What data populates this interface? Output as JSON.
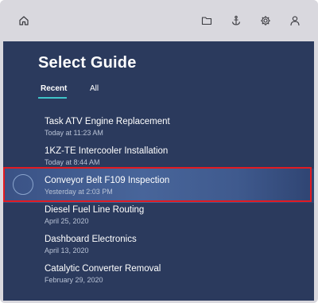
{
  "toolbar": {
    "home_icon": "home-icon",
    "folder_icon": "folder-icon",
    "anchor_icon": "anchor-icon",
    "settings_icon": "gear-icon",
    "user_icon": "user-icon"
  },
  "page": {
    "title": "Select Guide"
  },
  "tabs": [
    {
      "label": "Recent",
      "active": true
    },
    {
      "label": "All",
      "active": false
    }
  ],
  "guides": [
    {
      "title": "Task ATV Engine Replacement",
      "subtitle": "Today at 11:23 AM"
    },
    {
      "title": "1KZ-TE Intercooler Installation",
      "subtitle": "Today at 8:44 AM"
    },
    {
      "title": "Conveyor Belt F109 Inspection",
      "subtitle": "Yesterday at 2:03 PM",
      "selected": true
    },
    {
      "title": "Diesel Fuel Line Routing",
      "subtitle": "April 25, 2020"
    },
    {
      "title": "Dashboard Electronics",
      "subtitle": "April 13, 2020"
    },
    {
      "title": "Catalytic Converter Removal",
      "subtitle": "February 29, 2020"
    }
  ],
  "colors": {
    "panel": "#2b3a5d",
    "accent_underline": "#3fc4c8",
    "selection_outline": "#e11b22"
  }
}
